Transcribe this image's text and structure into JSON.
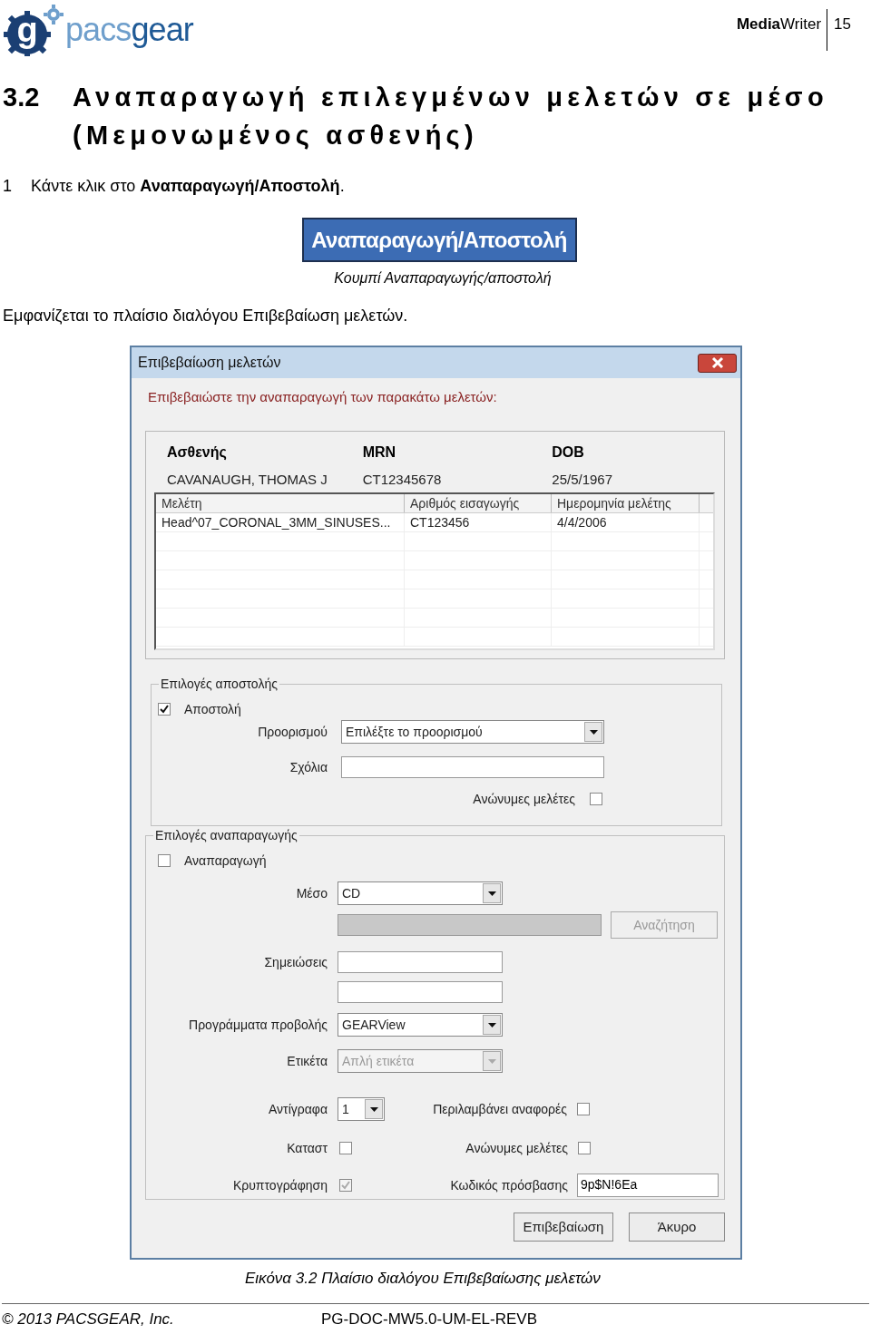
{
  "header": {
    "logo_mark": "g",
    "logo_part1": "pacs",
    "logo_part2": "gear",
    "product": "**Media**Writer",
    "page_number": "15"
  },
  "heading": {
    "number": "3.2",
    "title": "Αναπαραγωγή επιλεγμένων μελετών σε μέσο (Μεμονωμένος ασθενής)"
  },
  "step": {
    "number": "1",
    "text": "Κάντε κλικ στο **Αναπαραγωγή/Αποστολή**."
  },
  "button_figure": {
    "label": "Αναπαραγωγή/Αποστολή",
    "caption": "Κουμπί Αναπαραγωγής/αποστολή"
  },
  "paragraph": "Εμφανίζεται το πλαίσιο διαλόγου Επιβεβαίωση μελετών.",
  "dialog": {
    "title": "Επιβεβαίωση μελετών",
    "prompt": "Επιβεβαιώστε την αναπαραγωγή των παρακάτω μελετών:",
    "patient": {
      "headers": [
        "Ασθενής",
        "MRN",
        "DOB"
      ],
      "values": [
        "CAVANAUGH, THOMAS J",
        "CT12345678",
        "25/5/1967"
      ]
    },
    "studies": {
      "columns": [
        "Μελέτη",
        "Αριθμός εισαγωγής",
        "Ημερομηνία μελέτης"
      ],
      "rows": [
        [
          "Head^07_CORONAL_3MM_SINUSES...",
          "CT123456",
          "4/4/2006"
        ]
      ]
    },
    "send_options": {
      "legend": "Επιλογές αποστολής",
      "send": {
        "label": "Αποστολή",
        "checked": true
      },
      "destination": {
        "label": "Προορισμού",
        "value": "Επιλέξτε το προορισμού"
      },
      "comments": {
        "label": "Σχόλια"
      },
      "anonymous": {
        "label": "Ανώνυμες μελέτες",
        "checked": false
      }
    },
    "burn_options": {
      "legend": "Επιλογές αναπαραγωγής",
      "burn": {
        "label": "Αναπαραγωγή",
        "checked": false
      },
      "media": {
        "label": "Μέσο",
        "value": "CD"
      },
      "browse": {
        "label": "Αναζήτηση",
        "disabled": true
      },
      "notes": {
        "label": "Σημειώσεις"
      },
      "viewer": {
        "label": "Προγράμματα προβολής",
        "value": "GEARView"
      },
      "disc_label": {
        "label": "Ετικέτα",
        "value": "Απλή ετικέτα",
        "disabled": true
      },
      "copies": {
        "label": "Αντίγραφα",
        "value": "1"
      },
      "include_reports": {
        "label": "Περιλαμβάνει αναφορές",
        "checked": false
      },
      "status": {
        "label": "Καταστ",
        "checked": false
      },
      "anonymous": {
        "label": "Ανώνυμες μελέτες",
        "checked": false
      },
      "encryption": {
        "label": "Κρυπτογράφηση",
        "checked": true,
        "disabled": true
      },
      "password": {
        "label": "Κωδικός πρόσβασης",
        "value": "9p$N!6Ea"
      }
    },
    "buttons": [
      "Επιβεβαίωση",
      "Άκυρο"
    ]
  },
  "figure_caption": "Εικόνα 3.2 Πλαίσιο διαλόγου Επιβεβαίωσης μελετών",
  "footer": {
    "copyright": "© 2013 PACSGEAR, Inc.",
    "document_id": "PG-DOC-MW5.0-UM-EL-REVB"
  }
}
